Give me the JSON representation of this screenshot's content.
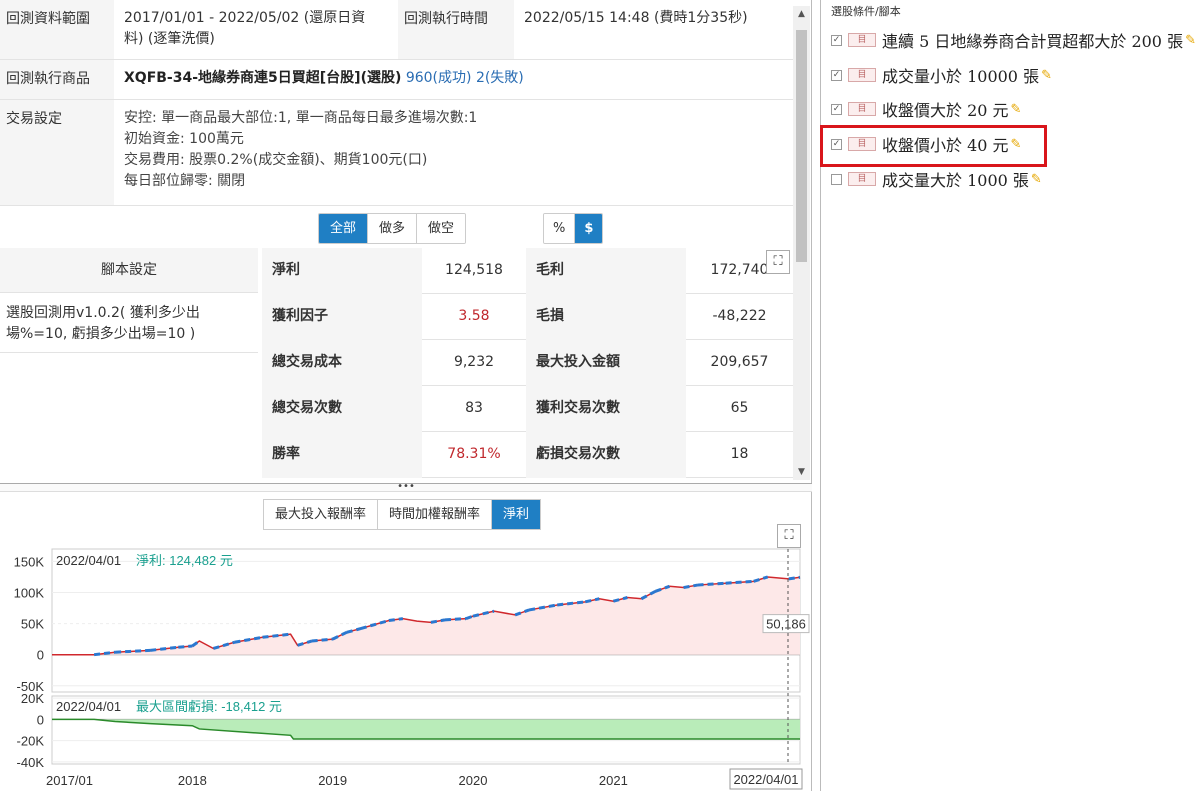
{
  "info": {
    "range_label": "回測資料範圍",
    "range_value_line1": "2017/01/01 - 2022/05/02 (還原日資",
    "range_value_line2": "料) (逐筆洗價)",
    "exec_time_label": "回測執行時間",
    "exec_time_value": "2022/05/15 14:48 (費時1分35秒)",
    "product_label": "回測執行商品",
    "product_name": "XQFB-34-地緣券商連5日買超[台股](選股)",
    "product_success": "960(成功)",
    "product_fail": "2(失敗)",
    "trade_label": "交易設定",
    "trade_lines": [
      "安控: 單一商品最大部位:1, 單一商品每日最多進場次數:1",
      "初始資金: 100萬元",
      "交易費用: 股票0.2%(成交金額)、期貨100元(口)",
      "每日部位歸零: 關閉"
    ]
  },
  "filter_buttons": [
    "全部",
    "做多",
    "做空"
  ],
  "unit_buttons": [
    "%",
    "$"
  ],
  "script": {
    "header": "腳本設定",
    "line1": "選股回測用v1.0.2( 獲利多少出",
    "line2": "場%=10, 虧損多少出場=10 )"
  },
  "metrics": [
    {
      "k1": "淨利",
      "v1": "124,518",
      "k2": "毛利",
      "v2": "172,740",
      "red": false
    },
    {
      "k1": "獲利因子",
      "v1": "3.58",
      "k2": "毛損",
      "v2": "-48,222",
      "red": true
    },
    {
      "k1": "總交易成本",
      "v1": "9,232",
      "k2": "最大投入金額",
      "v2": "209,657",
      "red": false
    },
    {
      "k1": "總交易次數",
      "v1": "83",
      "k2": "獲利交易次數",
      "v2": "65",
      "red": false
    },
    {
      "k1": "勝率",
      "v1": "78.31%",
      "k2": "虧損交易次數",
      "v2": "18",
      "red": true
    }
  ],
  "chart_tabs": [
    "最大投入報酬率",
    "時間加權報酬率",
    "淨利"
  ],
  "expand_glyph": "⛶",
  "splitter_glyph": "•••",
  "chart_data": [
    {
      "type": "line",
      "legend_date": "2022/04/01",
      "legend_text": "淨利: 124,482 元",
      "y_ticks": [
        "150K",
        "100K",
        "50K",
        "0",
        "-50K"
      ],
      "ylim": [
        -60000,
        170000
      ],
      "marker_value_label": "50,186",
      "x": [
        2017.0,
        2017.3,
        2017.45,
        2017.7,
        2017.9,
        2018.0,
        2018.05,
        2018.15,
        2018.3,
        2018.5,
        2018.7,
        2018.75,
        2018.85,
        2019.0,
        2019.1,
        2019.2,
        2019.4,
        2019.5,
        2019.6,
        2019.7,
        2019.8,
        2019.95,
        2020.0,
        2020.15,
        2020.3,
        2020.4,
        2020.6,
        2020.8,
        2020.9,
        2021.0,
        2021.1,
        2021.2,
        2021.3,
        2021.4,
        2021.5,
        2021.6,
        2021.8,
        2022.0,
        2022.1,
        2022.25,
        2022.33
      ],
      "values": [
        0,
        0,
        4000,
        7000,
        12000,
        14000,
        22000,
        10000,
        20000,
        28000,
        33000,
        15000,
        22000,
        25000,
        36000,
        42000,
        55000,
        58000,
        54000,
        52000,
        56000,
        58000,
        62000,
        70000,
        64000,
        72000,
        80000,
        85000,
        90000,
        86000,
        92000,
        90000,
        102000,
        110000,
        108000,
        112000,
        115000,
        118000,
        125000,
        122000,
        124482
      ]
    },
    {
      "type": "area",
      "legend_date": "2022/04/01",
      "legend_text": "最大區間虧損: -18,412 元",
      "y_ticks": [
        "20K",
        "0",
        "-20K",
        "-40K"
      ],
      "ylim": [
        -42000,
        22000
      ],
      "x": [
        2017.0,
        2017.3,
        2017.45,
        2017.7,
        2018.0,
        2018.05,
        2018.7,
        2018.72,
        2019.0,
        2022.33
      ],
      "values": [
        0,
        0,
        -2000,
        -4000,
        -6000,
        -9000,
        -15000,
        -18412,
        -18412,
        -18412
      ]
    }
  ],
  "x_ticks": [
    "2017/01",
    "2018",
    "2019",
    "2020",
    "2021",
    "2022"
  ],
  "x_end_label": "2022/04/01",
  "right_panel": {
    "title": "選股條件/腳本",
    "doc_icon_glyph": "目",
    "check_glyph": "☑",
    "pencil_glyph": "✎",
    "conditions": [
      {
        "text": "連續 5 日地緣券商合計買超都大於 200 張",
        "checked": true
      },
      {
        "text": "成交量小於 10000 張",
        "checked": true
      },
      {
        "text": "收盤價大於 20 元",
        "checked": true
      },
      {
        "text": "收盤價小於 40 元",
        "checked": true
      },
      {
        "text": "成交量大於 1000 張",
        "checked": false
      }
    ]
  },
  "colors": {
    "accent": "#1f7fc4",
    "red_text": "#c0282d",
    "highlight": "#d9151b",
    "line_red": "#d0282d",
    "line_blue": "#2a78d0",
    "area_green": "#b9ecb9"
  }
}
